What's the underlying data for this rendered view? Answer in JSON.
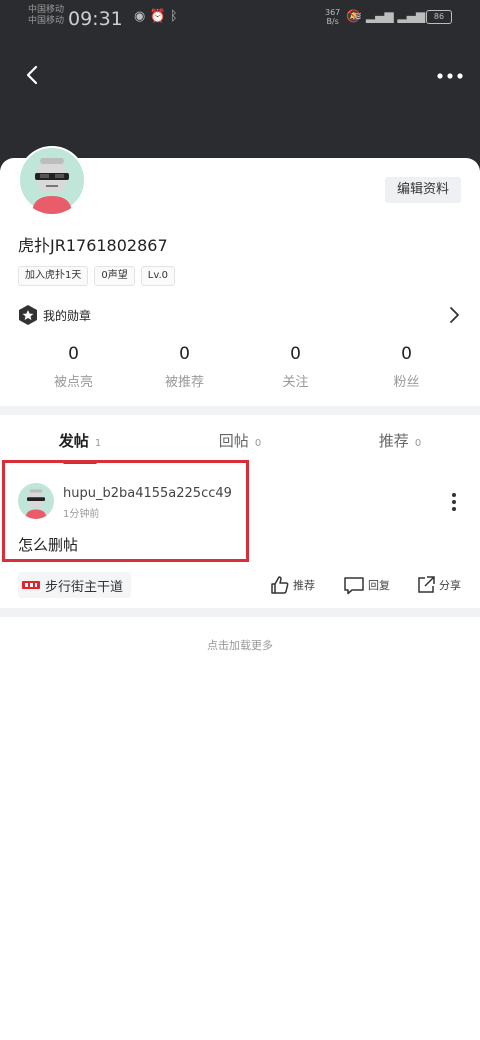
{
  "status_bar": {
    "carrier_1": "中国移动",
    "carrier_2": "中国移动",
    "time": "09:31",
    "net_speed_value": "367",
    "net_speed_unit": "B/s",
    "battery": "86"
  },
  "profile": {
    "username": "虎扑JR1761802867",
    "edit_label": "编辑资料",
    "tags": [
      "加入虎扑1天",
      "0声望",
      "Lv.0"
    ],
    "medal_label": "我的勋章",
    "stats": [
      {
        "value": "0",
        "label": "被点亮"
      },
      {
        "value": "0",
        "label": "被推荐"
      },
      {
        "value": "0",
        "label": "关注"
      },
      {
        "value": "0",
        "label": "粉丝"
      }
    ]
  },
  "tabs": [
    {
      "label": "发帖",
      "count": "1"
    },
    {
      "label": "回帖",
      "count": "0"
    },
    {
      "label": "推荐",
      "count": "0"
    }
  ],
  "post": {
    "author": "hupu_b2ba4155a225cc49",
    "time": "1分钟前",
    "title": "怎么删帖",
    "board": "步行街主干道",
    "actions": {
      "recommend": "推荐",
      "reply": "回复",
      "share": "分享"
    }
  },
  "load_more": "点击加载更多",
  "colors": {
    "accent": "#e5212b",
    "header_bg": "#2b2c2f",
    "highlight": "#d92e3a"
  },
  "icons": [
    "back-icon",
    "more-icon",
    "medal-icon",
    "chevron-right-icon",
    "kebab-icon",
    "thumb-up-icon",
    "comment-icon",
    "share-icon"
  ]
}
